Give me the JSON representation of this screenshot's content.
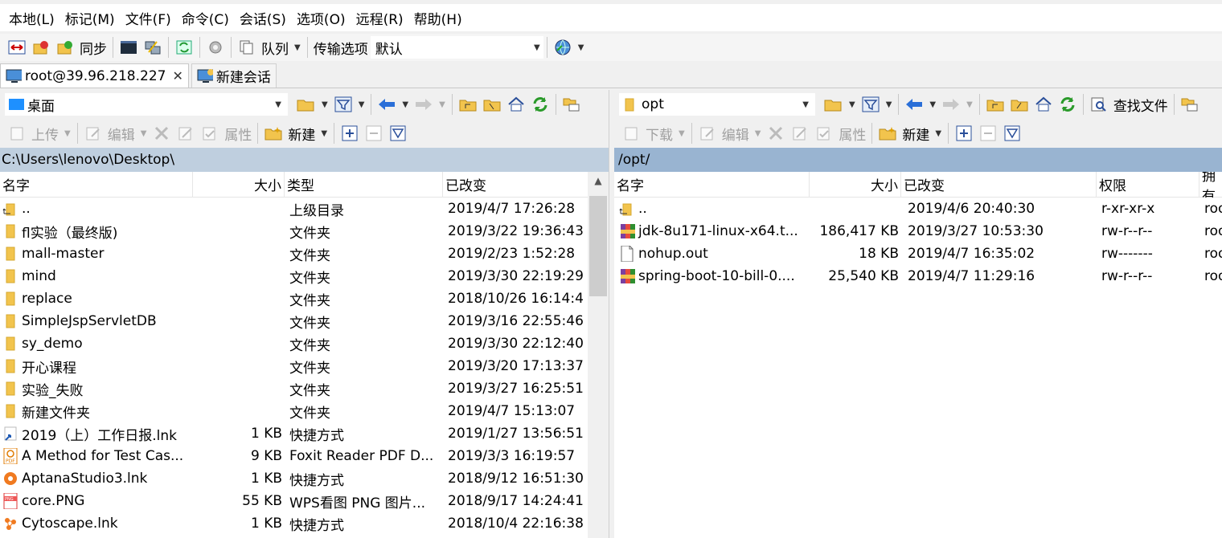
{
  "menu": [
    "本地(L)",
    "标记(M)",
    "文件(F)",
    "命令(C)",
    "会话(S)",
    "选项(O)",
    "远程(R)",
    "帮助(H)"
  ],
  "toolbar": {
    "sync_label": "同步",
    "queue_label": "队列",
    "transfer_options_label": "传输选项",
    "transfer_preset": "默认"
  },
  "tabs": {
    "session": "root@39.96.218.227",
    "new_session": "新建会话"
  },
  "left": {
    "location": "桌面",
    "upload_label": "上传",
    "edit_label": "编辑",
    "properties_label": "属性",
    "new_label": "新建",
    "path": "C:\\Users\\lenovo\\Desktop\\",
    "columns": [
      "名字",
      "大小",
      "类型",
      "已改变"
    ],
    "rows": [
      {
        "name": "..",
        "size": "",
        "type": "上级目录",
        "changed": "2019/4/7  17:26:28",
        "icon": "parent-folder"
      },
      {
        "name": "fl实验（最终版)",
        "size": "",
        "type": "文件夹",
        "changed": "2019/3/22  19:36:43",
        "icon": "folder"
      },
      {
        "name": "mall-master",
        "size": "",
        "type": "文件夹",
        "changed": "2019/2/23  1:52:28",
        "icon": "folder"
      },
      {
        "name": "mind",
        "size": "",
        "type": "文件夹",
        "changed": "2019/3/30  22:19:29",
        "icon": "folder"
      },
      {
        "name": "replace",
        "size": "",
        "type": "文件夹",
        "changed": "2018/10/26  16:14:4",
        "icon": "folder"
      },
      {
        "name": "SimpleJspServletDB",
        "size": "",
        "type": "文件夹",
        "changed": "2019/3/16  22:55:46",
        "icon": "folder"
      },
      {
        "name": "sy_demo",
        "size": "",
        "type": "文件夹",
        "changed": "2019/3/30  22:12:40",
        "icon": "folder"
      },
      {
        "name": "开心课程",
        "size": "",
        "type": "文件夹",
        "changed": "2019/3/20  17:13:37",
        "icon": "folder"
      },
      {
        "name": "实验_失败",
        "size": "",
        "type": "文件夹",
        "changed": "2019/3/27  16:25:51",
        "icon": "folder"
      },
      {
        "name": "新建文件夹",
        "size": "",
        "type": "文件夹",
        "changed": "2019/4/7  15:13:07",
        "icon": "folder"
      },
      {
        "name": "2019（上）工作日报.lnk",
        "size": "1 KB",
        "type": "快捷方式",
        "changed": "2019/1/27  13:56:51",
        "icon": "shortcut"
      },
      {
        "name": "A Method for Test Cas...",
        "size": "9 KB",
        "type": "Foxit Reader PDF D...",
        "changed": "2019/3/3  16:19:57",
        "icon": "pdf"
      },
      {
        "name": "AptanaStudio3.lnk",
        "size": "1 KB",
        "type": "快捷方式",
        "changed": "2018/9/12  16:51:30",
        "icon": "aptana"
      },
      {
        "name": "core.PNG",
        "size": "55 KB",
        "type": "WPS看图 PNG 图片...",
        "changed": "2018/9/17  14:24:41",
        "icon": "png"
      },
      {
        "name": "Cytoscape.lnk",
        "size": "1 KB",
        "type": "快捷方式",
        "changed": "2018/10/4  22:16:38",
        "icon": "cytoscape"
      }
    ]
  },
  "right": {
    "location": "opt",
    "find_files_label": "查找文件",
    "download_label": "下载",
    "edit_label": "编辑",
    "properties_label": "属性",
    "new_label": "新建",
    "path": "/opt/",
    "columns": [
      "名字",
      "大小",
      "已改变",
      "权限",
      "拥有"
    ],
    "rows": [
      {
        "name": "..",
        "size": "",
        "changed": "2019/4/6 20:40:30",
        "perm": "r-xr-xr-x",
        "owner": "root",
        "icon": "parent-folder"
      },
      {
        "name": "jdk-8u171-linux-x64.t...",
        "size": "186,417 KB",
        "changed": "2019/3/27 10:53:30",
        "perm": "rw-r--r--",
        "owner": "root",
        "icon": "archive"
      },
      {
        "name": "nohup.out",
        "size": "18 KB",
        "changed": "2019/4/7 16:35:02",
        "perm": "rw-------",
        "owner": "root",
        "icon": "file"
      },
      {
        "name": "spring-boot-10-bill-0....",
        "size": "25,540 KB",
        "changed": "2019/4/7 11:29:16",
        "perm": "rw-r--r--",
        "owner": "root",
        "icon": "archive"
      }
    ]
  },
  "colors": {
    "left_path_bg": "#bfcfdf",
    "right_path_bg": "#99b4d1",
    "folder": "#f2c44d"
  }
}
